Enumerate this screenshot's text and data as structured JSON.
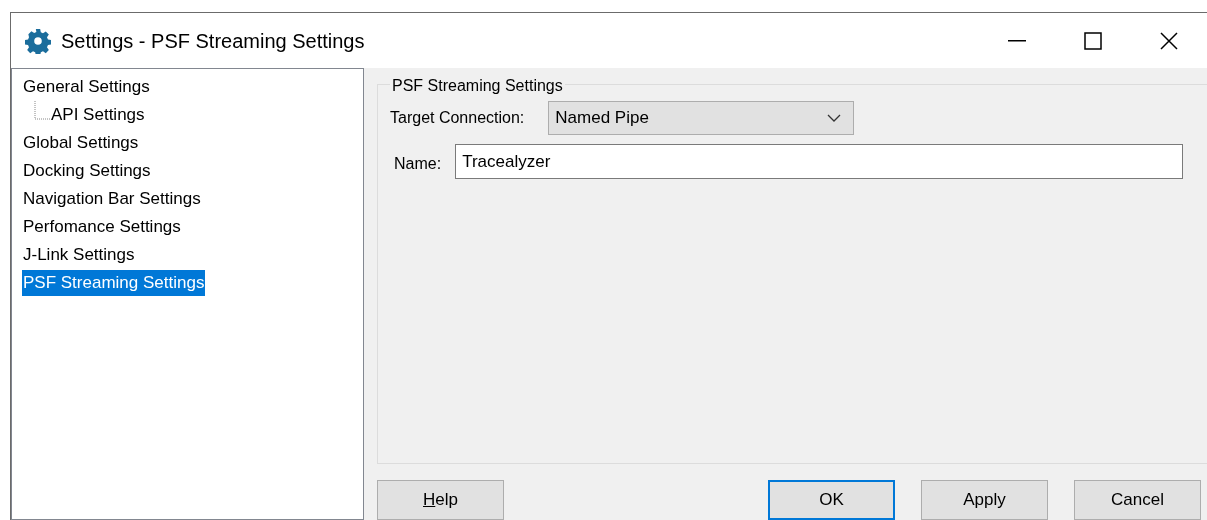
{
  "window": {
    "title": "Settings - PSF Streaming Settings"
  },
  "sidebar": {
    "items": [
      {
        "label": "General Settings",
        "selected": false,
        "children": [
          {
            "label": "API Settings",
            "selected": false
          }
        ]
      },
      {
        "label": "Global Settings",
        "selected": false
      },
      {
        "label": "Docking Settings",
        "selected": false
      },
      {
        "label": "Navigation Bar Settings",
        "selected": false
      },
      {
        "label": "Perfomance Settings",
        "selected": false
      },
      {
        "label": "J-Link Settings",
        "selected": false
      },
      {
        "label": "PSF Streaming Settings",
        "selected": true
      }
    ]
  },
  "group": {
    "title": "PSF Streaming Settings",
    "target_connection": {
      "label": "Target Connection:",
      "value": "Named Pipe"
    },
    "name": {
      "label": "Name:",
      "value": "Tracealyzer"
    }
  },
  "buttons": [
    {
      "label": "Help",
      "underline_first": true,
      "default": false
    },
    {
      "label": "OK",
      "underline_first": false,
      "default": true
    },
    {
      "label": "Apply",
      "underline_first": false,
      "default": false
    },
    {
      "label": "Cancel",
      "underline_first": false,
      "default": false
    }
  ]
}
